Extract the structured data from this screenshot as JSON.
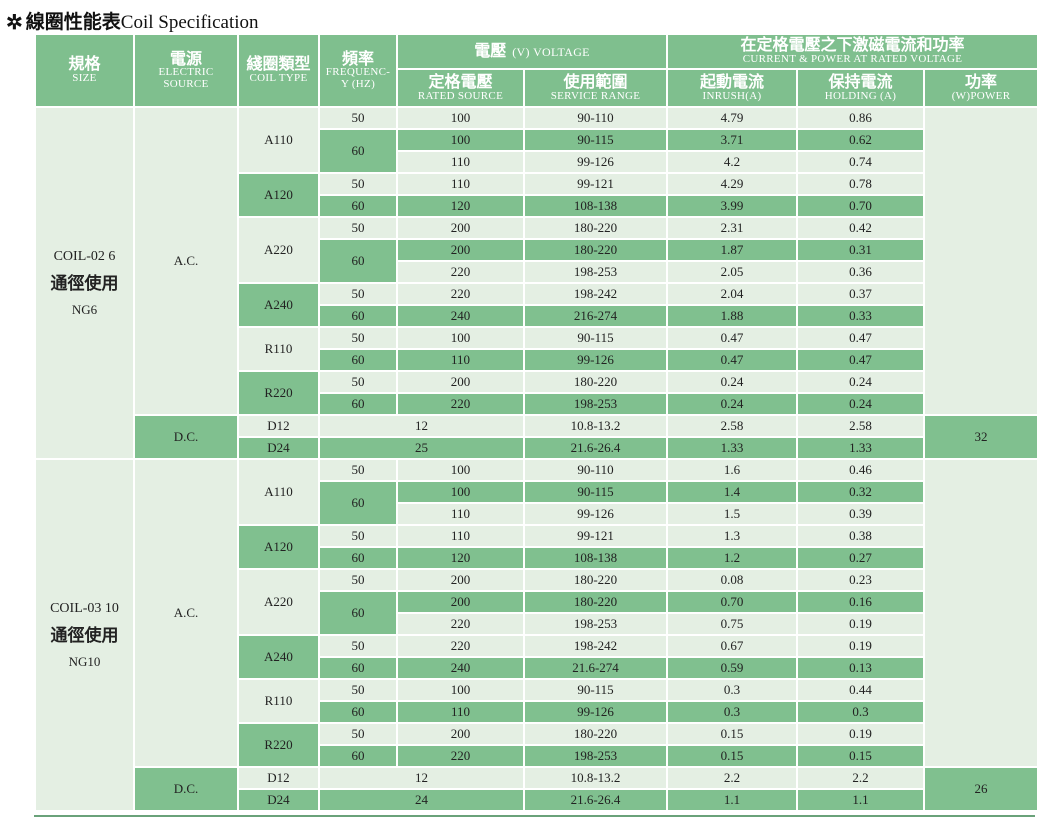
{
  "title": {
    "icon": "snowflake-icon",
    "zh": "線圈性能表",
    "en": "Coil Specification"
  },
  "colors": {
    "dark": "#80c08f",
    "light": "#e4efe3",
    "header": "#7fbf8e"
  },
  "headers": {
    "size": {
      "zh": "規格",
      "en": "SIZE"
    },
    "source": {
      "zh": "電源",
      "en1": "ELECTRIC",
      "en2": "SOURCE"
    },
    "coil_type": {
      "zh": "綫圈類型",
      "en": "COIL TYPE"
    },
    "freq": {
      "zh": "頻率",
      "en1": "FREQUENC-",
      "en2": "Y (HZ)"
    },
    "voltage": {
      "zh": "電壓",
      "en": "(V) VOLTAGE"
    },
    "current": {
      "zh": "在定格電壓之下激磁電流和功率",
      "en": "CURRENT & POWER AT RATED VOLTAGE"
    },
    "rated": {
      "zh": "定格電壓",
      "en": "RATED SOURCE"
    },
    "range": {
      "zh": "使用範圍",
      "en": "SERVICE RANGE"
    },
    "inrush": {
      "zh": "起動電流",
      "en": "INRUSH(A)"
    },
    "holding": {
      "zh": "保持電流",
      "en": "HOLDING (A)"
    },
    "power": {
      "zh": "功率",
      "en": "(W)POWER"
    }
  },
  "sections": [
    {
      "spec_code": "COIL-02 6",
      "spec_zh": "通徑使用",
      "spec_ng": "NG6",
      "ac_label": "A.C.",
      "dc_label": "D.C.",
      "dc_power": "32",
      "ac_groups": [
        {
          "type": "A110",
          "freq_groups": [
            {
              "freq": "50",
              "rows": [
                {
                  "rated": "100",
                  "range": "90-110",
                  "inrush": "4.79",
                  "holding": "0.86"
                }
              ]
            },
            {
              "freq": "60",
              "rows": [
                {
                  "rated": "100",
                  "range": "90-115",
                  "inrush": "3.71",
                  "holding": "0.62"
                },
                {
                  "rated": "110",
                  "range": "99-126",
                  "inrush": "4.2",
                  "holding": "0.74"
                }
              ]
            }
          ]
        },
        {
          "type": "A120",
          "freq_groups": [
            {
              "freq": "50",
              "rows": [
                {
                  "rated": "110",
                  "range": "99-121",
                  "inrush": "4.29",
                  "holding": "0.78"
                }
              ]
            },
            {
              "freq": "60",
              "rows": [
                {
                  "rated": "120",
                  "range": "108-138",
                  "inrush": "3.99",
                  "holding": "0.70"
                }
              ]
            }
          ]
        },
        {
          "type": "A220",
          "freq_groups": [
            {
              "freq": "50",
              "rows": [
                {
                  "rated": "200",
                  "range": "180-220",
                  "inrush": "2.31",
                  "holding": "0.42"
                }
              ]
            },
            {
              "freq": "60",
              "rows": [
                {
                  "rated": "200",
                  "range": "180-220",
                  "inrush": "1.87",
                  "holding": "0.31"
                },
                {
                  "rated": "220",
                  "range": "198-253",
                  "inrush": "2.05",
                  "holding": "0.36"
                }
              ]
            }
          ]
        },
        {
          "type": "A240",
          "freq_groups": [
            {
              "freq": "50",
              "rows": [
                {
                  "rated": "220",
                  "range": "198-242",
                  "inrush": "2.04",
                  "holding": "0.37"
                }
              ]
            },
            {
              "freq": "60",
              "rows": [
                {
                  "rated": "240",
                  "range": "216-274",
                  "inrush": "1.88",
                  "holding": "0.33"
                }
              ]
            }
          ]
        },
        {
          "type": "R110",
          "freq_groups": [
            {
              "freq": "50",
              "rows": [
                {
                  "rated": "100",
                  "range": "90-115",
                  "inrush": "0.47",
                  "holding": "0.47"
                }
              ]
            },
            {
              "freq": "60",
              "rows": [
                {
                  "rated": "110",
                  "range": "99-126",
                  "inrush": "0.47",
                  "holding": "0.47"
                }
              ]
            }
          ]
        },
        {
          "type": "R220",
          "freq_groups": [
            {
              "freq": "50",
              "rows": [
                {
                  "rated": "200",
                  "range": "180-220",
                  "inrush": "0.24",
                  "holding": "0.24"
                }
              ]
            },
            {
              "freq": "60",
              "rows": [
                {
                  "rated": "220",
                  "range": "198-253",
                  "inrush": "0.24",
                  "holding": "0.24"
                }
              ]
            }
          ]
        }
      ],
      "dc_rows": [
        {
          "type": "D12",
          "rated": "12",
          "range": "10.8-13.2",
          "inrush": "2.58",
          "holding": "2.58"
        },
        {
          "type": "D24",
          "rated": "25",
          "range": "21.6-26.4",
          "inrush": "1.33",
          "holding": "1.33"
        }
      ]
    },
    {
      "spec_code": "COIL-03 10",
      "spec_zh": "通徑使用",
      "spec_ng": "NG10",
      "ac_label": "A.C.",
      "dc_label": "D.C.",
      "dc_power": "26",
      "ac_groups": [
        {
          "type": "A110",
          "freq_groups": [
            {
              "freq": "50",
              "rows": [
                {
                  "rated": "100",
                  "range": "90-110",
                  "inrush": "1.6",
                  "holding": "0.46"
                }
              ]
            },
            {
              "freq": "60",
              "rows": [
                {
                  "rated": "100",
                  "range": "90-115",
                  "inrush": "1.4",
                  "holding": "0.32"
                },
                {
                  "rated": "110",
                  "range": "99-126",
                  "inrush": "1.5",
                  "holding": "0.39"
                }
              ]
            }
          ]
        },
        {
          "type": "A120",
          "freq_groups": [
            {
              "freq": "50",
              "rows": [
                {
                  "rated": "110",
                  "range": "99-121",
                  "inrush": "1.3",
                  "holding": "0.38"
                }
              ]
            },
            {
              "freq": "60",
              "rows": [
                {
                  "rated": "120",
                  "range": "108-138",
                  "inrush": "1.2",
                  "holding": "0.27"
                }
              ]
            }
          ]
        },
        {
          "type": "A220",
          "freq_groups": [
            {
              "freq": "50",
              "rows": [
                {
                  "rated": "200",
                  "range": "180-220",
                  "inrush": "0.08",
                  "holding": "0.23"
                }
              ]
            },
            {
              "freq": "60",
              "rows": [
                {
                  "rated": "200",
                  "range": "180-220",
                  "inrush": "0.70",
                  "holding": "0.16"
                },
                {
                  "rated": "220",
                  "range": "198-253",
                  "inrush": "0.75",
                  "holding": "0.19"
                }
              ]
            }
          ]
        },
        {
          "type": "A240",
          "freq_groups": [
            {
              "freq": "50",
              "rows": [
                {
                  "rated": "220",
                  "range": "198-242",
                  "inrush": "0.67",
                  "holding": "0.19"
                }
              ]
            },
            {
              "freq": "60",
              "rows": [
                {
                  "rated": "240",
                  "range": "21.6-274",
                  "inrush": "0.59",
                  "holding": "0.13"
                }
              ]
            }
          ]
        },
        {
          "type": "R110",
          "freq_groups": [
            {
              "freq": "50",
              "rows": [
                {
                  "rated": "100",
                  "range": "90-115",
                  "inrush": "0.3",
                  "holding": "0.44"
                }
              ]
            },
            {
              "freq": "60",
              "rows": [
                {
                  "rated": "110",
                  "range": "99-126",
                  "inrush": "0.3",
                  "holding": "0.3"
                }
              ]
            }
          ]
        },
        {
          "type": "R220",
          "freq_groups": [
            {
              "freq": "50",
              "rows": [
                {
                  "rated": "200",
                  "range": "180-220",
                  "inrush": "0.15",
                  "holding": "0.19"
                }
              ]
            },
            {
              "freq": "60",
              "rows": [
                {
                  "rated": "220",
                  "range": "198-253",
                  "inrush": "0.15",
                  "holding": "0.15"
                }
              ]
            }
          ]
        }
      ],
      "dc_rows": [
        {
          "type": "D12",
          "rated": "12",
          "range": "10.8-13.2",
          "inrush": "2.2",
          "holding": "2.2"
        },
        {
          "type": "D24",
          "rated": "24",
          "range": "21.6-26.4",
          "inrush": "1.1",
          "holding": "1.1"
        }
      ]
    }
  ]
}
